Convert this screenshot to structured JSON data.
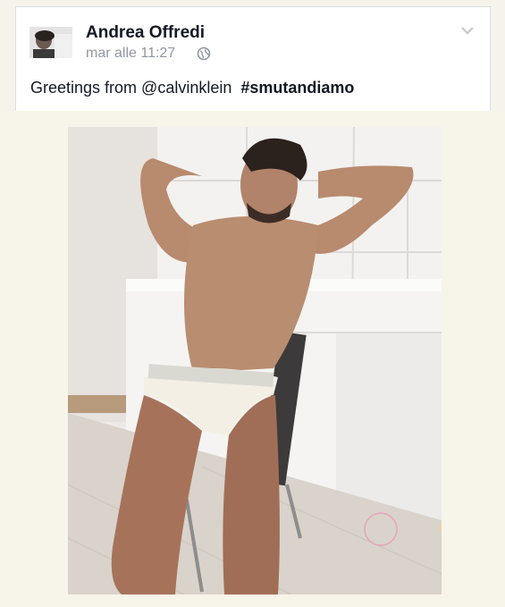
{
  "post": {
    "author": "Andrea Offredi",
    "timestamp": "mar alle 11:27",
    "text_prefix": "Greetings from @calvinklein",
    "hashtag": "#smutandiamo",
    "privacy_icon": "globe-icon",
    "menu_icon": "chevron-down-icon"
  },
  "colors": {
    "author": "#141823",
    "meta": "#9197a3",
    "background": "#f6f4ea"
  }
}
